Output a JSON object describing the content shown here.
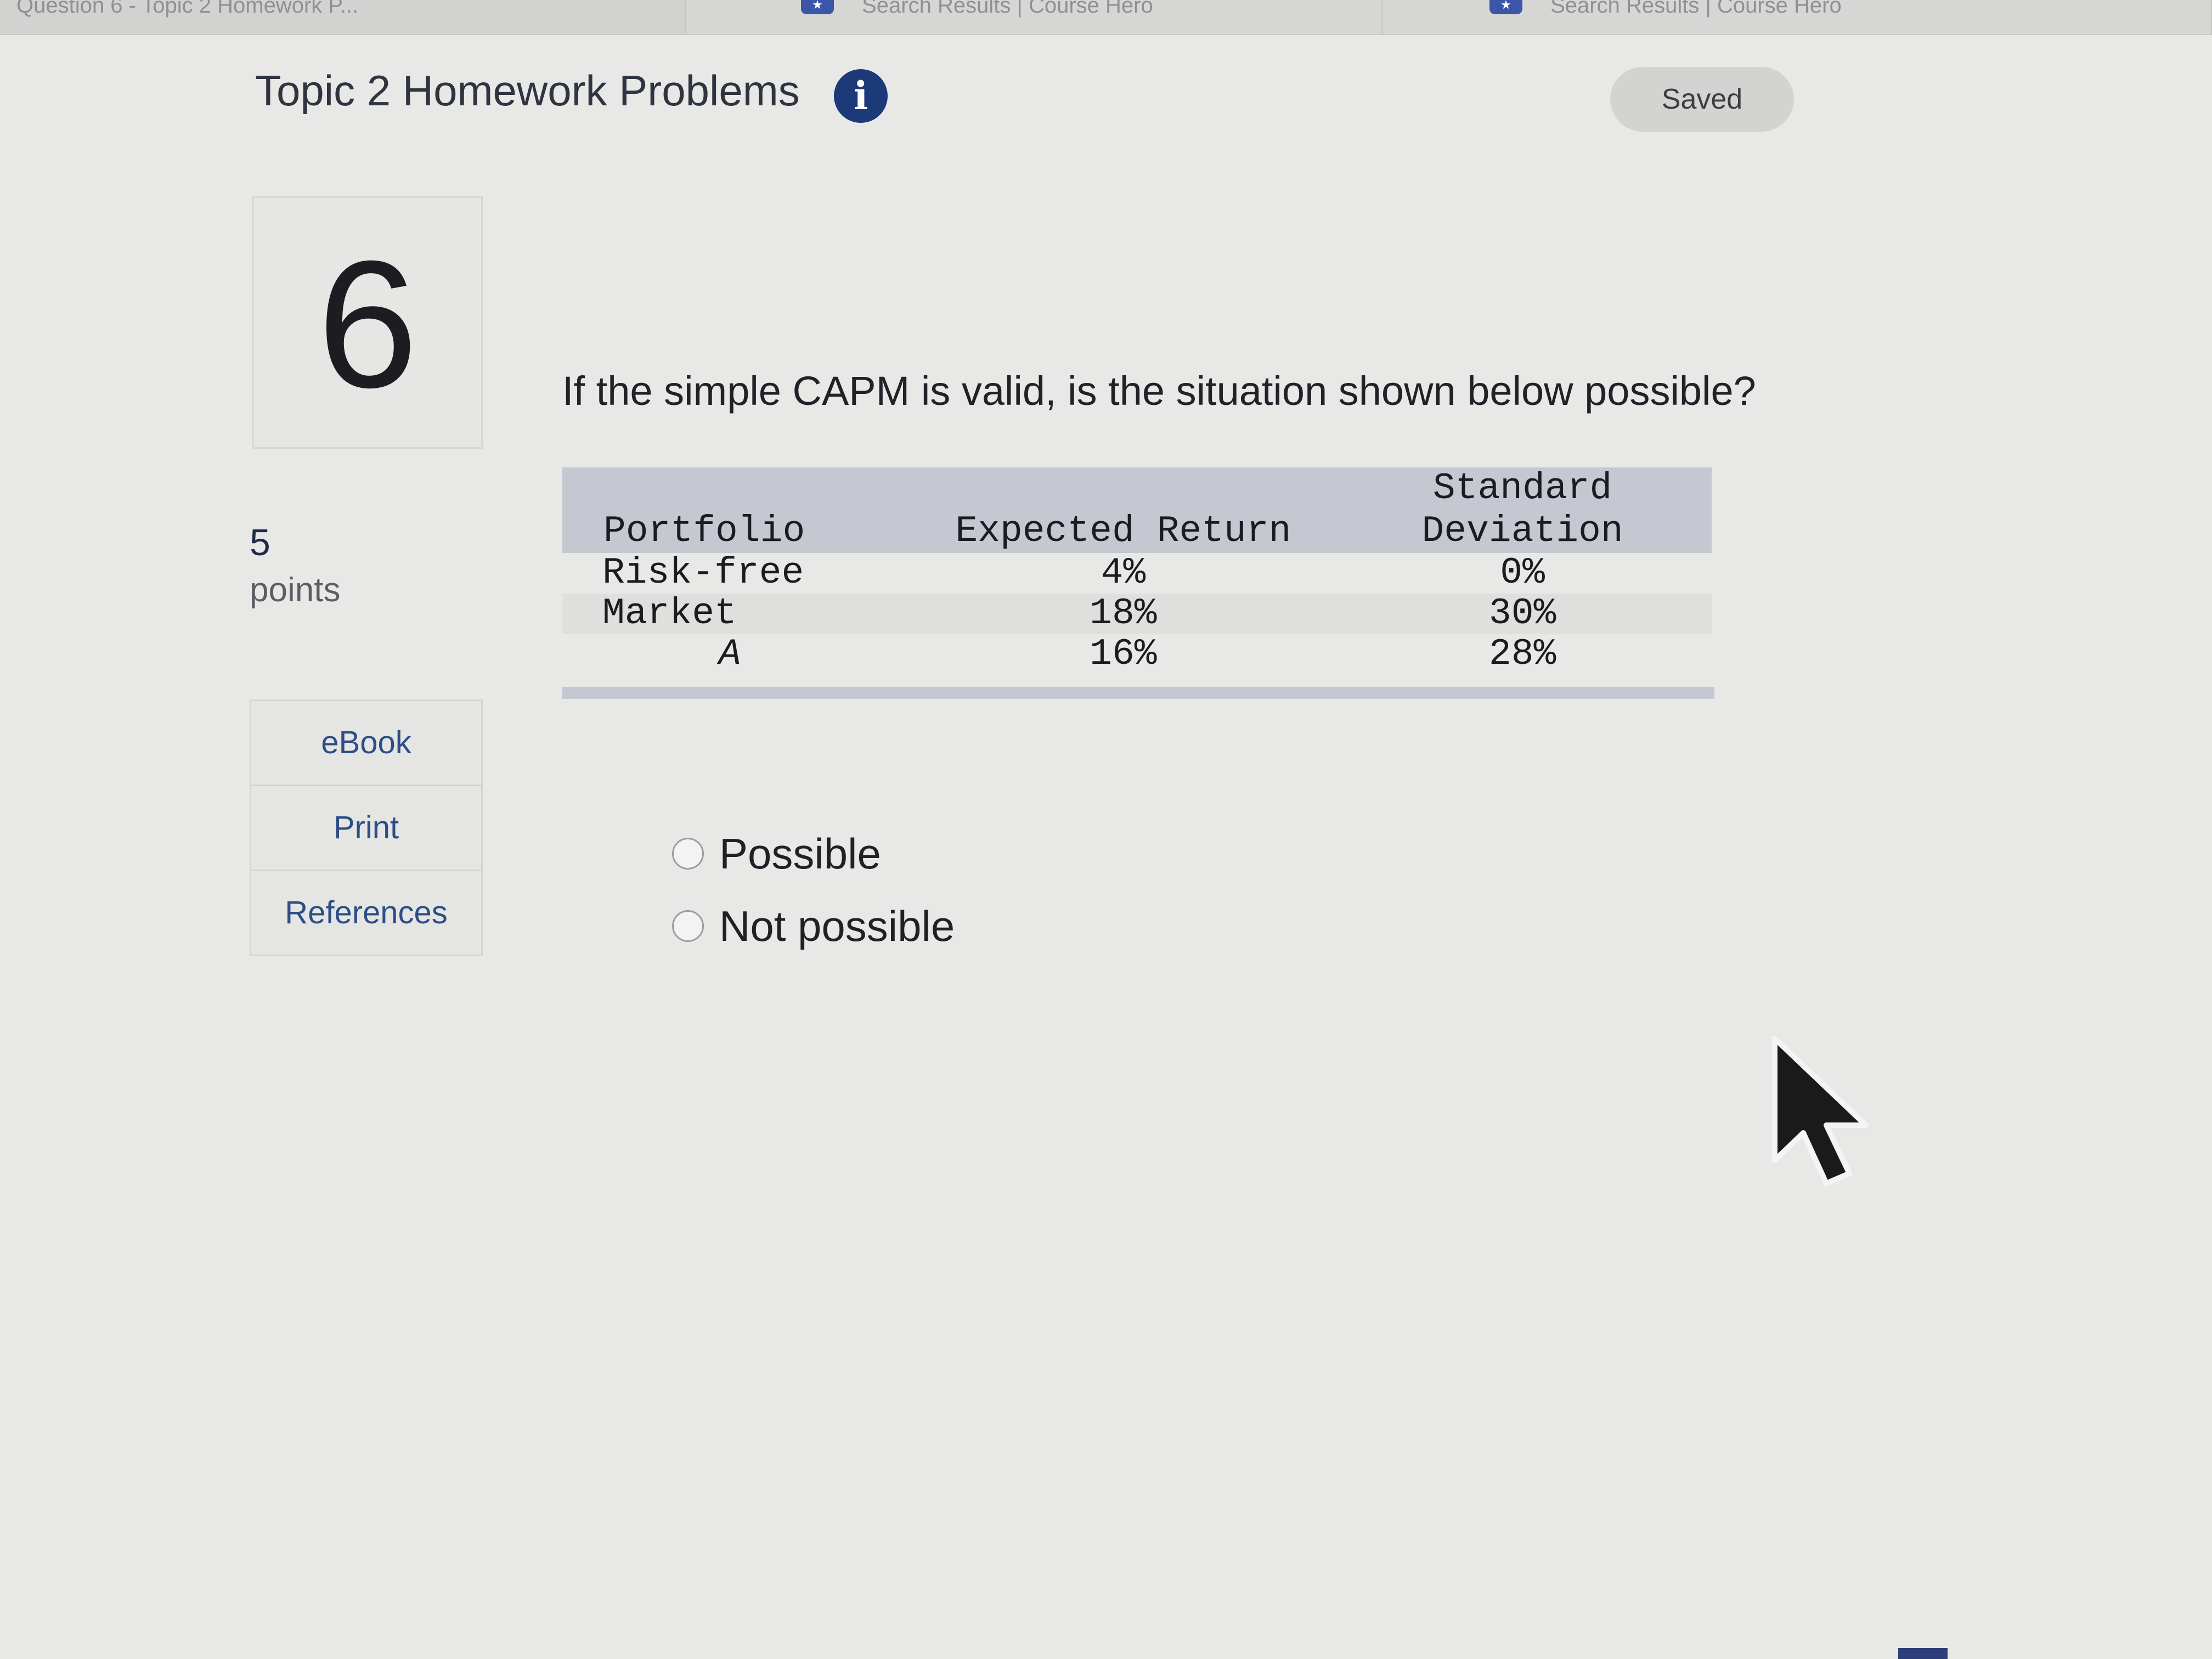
{
  "browser": {
    "tabs": [
      {
        "label": "Question 6 - Topic 2 Homework P..."
      },
      {
        "label": "Search Results | Course Hero"
      },
      {
        "label": "Search Results | Course Hero"
      }
    ]
  },
  "header": {
    "title": "Topic 2 Homework Problems",
    "info_icon": "info-icon",
    "status": "Saved"
  },
  "question": {
    "number": "6",
    "points_value": "5",
    "points_label": "points",
    "text": "If the simple CAPM is valid, is the situation shown below possible?",
    "table": {
      "headers": [
        "Portfolio",
        "Expected Return",
        "Standard",
        "Deviation"
      ],
      "rows": [
        {
          "portfolio": "Risk-free",
          "expected_return": "4%",
          "std_dev": "0%"
        },
        {
          "portfolio": "Market",
          "expected_return": "18%",
          "std_dev": "30%"
        },
        {
          "portfolio": "A",
          "expected_return": "16%",
          "std_dev": "28%"
        }
      ]
    },
    "options": [
      {
        "label": "Possible",
        "selected": false
      },
      {
        "label": "Not possible",
        "selected": false
      }
    ]
  },
  "sidebar": {
    "items": [
      {
        "label": "eBook"
      },
      {
        "label": "Print"
      },
      {
        "label": "References"
      }
    ]
  },
  "colors": {
    "accent": "#1d3a78",
    "link": "#2e4d86",
    "table_header": "#c5c8d0"
  }
}
